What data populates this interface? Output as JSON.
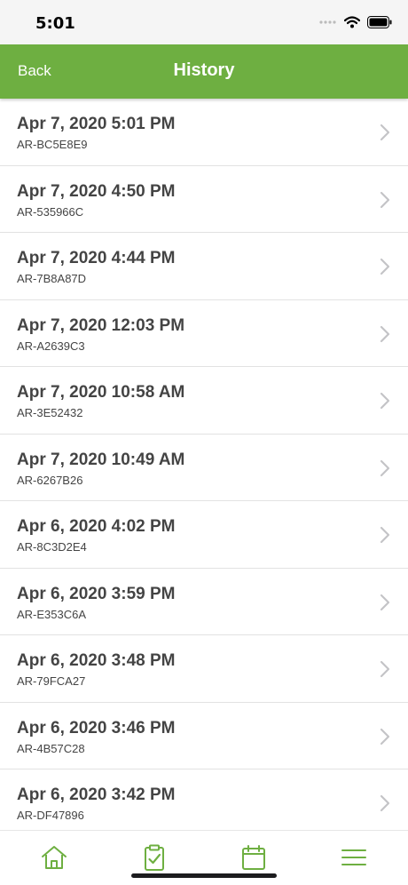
{
  "status_bar": {
    "time": "5:01",
    "icons": [
      "signal-dots-icon",
      "wifi-icon",
      "battery-icon"
    ]
  },
  "nav": {
    "back_label": "Back",
    "title": "History",
    "accent_color": "#6eaf41"
  },
  "history": [
    {
      "datetime": "Apr 7, 2020 5:01 PM",
      "code": "AR-BC5E8E9"
    },
    {
      "datetime": "Apr 7, 2020 4:50 PM",
      "code": "AR-535966C"
    },
    {
      "datetime": "Apr 7, 2020 4:44 PM",
      "code": "AR-7B8A87D"
    },
    {
      "datetime": "Apr 7, 2020 12:03 PM",
      "code": "AR-A2639C3"
    },
    {
      "datetime": "Apr 7, 2020 10:58 AM",
      "code": "AR-3E52432"
    },
    {
      "datetime": "Apr 7, 2020 10:49 AM",
      "code": "AR-6267B26"
    },
    {
      "datetime": "Apr 6, 2020 4:02 PM",
      "code": "AR-8C3D2E4"
    },
    {
      "datetime": "Apr 6, 2020 3:59 PM",
      "code": "AR-E353C6A"
    },
    {
      "datetime": "Apr 6, 2020 3:48 PM",
      "code": "AR-79FCA27"
    },
    {
      "datetime": "Apr 6, 2020 3:46 PM",
      "code": "AR-4B57C28"
    },
    {
      "datetime": "Apr 6, 2020 3:42 PM",
      "code": "AR-DF47896"
    }
  ],
  "tab_bar": {
    "icons": [
      "home-icon",
      "clipboard-check-icon",
      "calendar-icon",
      "menu-icon"
    ]
  }
}
